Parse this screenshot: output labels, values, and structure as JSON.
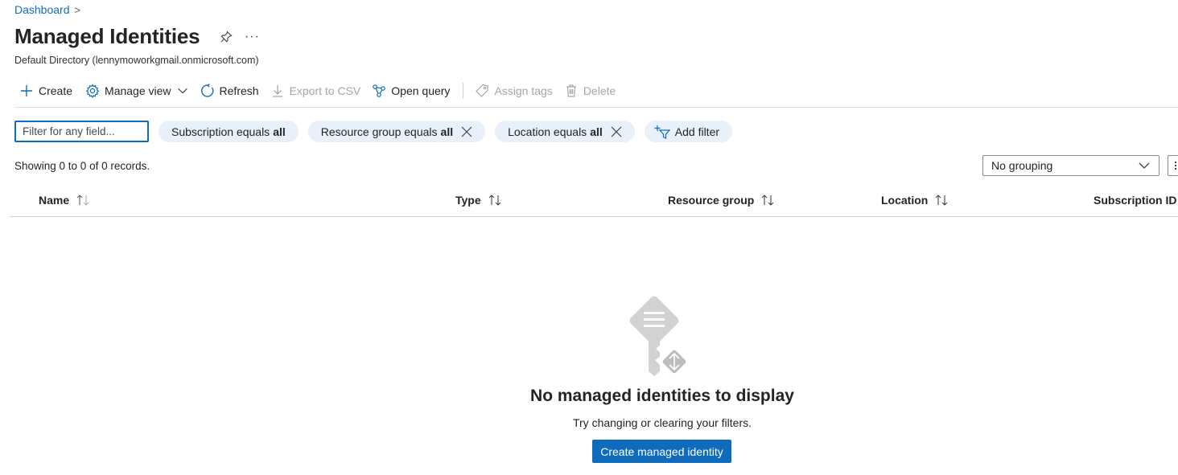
{
  "breadcrumb": {
    "link": "Dashboard"
  },
  "header": {
    "title": "Managed Identities",
    "more": "···",
    "subtitle": "Default Directory (lennymoworkgmail.onmicrosoft.com)"
  },
  "toolbar": {
    "create": "Create",
    "manage_view": "Manage view",
    "refresh": "Refresh",
    "export_csv": "Export to CSV",
    "open_query": "Open query",
    "assign_tags": "Assign tags",
    "delete": "Delete"
  },
  "filters": {
    "input_placeholder": "Filter for any field...",
    "pills": [
      {
        "label": "Subscription equals",
        "value": "all",
        "removable": false
      },
      {
        "label": "Resource group equals",
        "value": "all",
        "removable": true
      },
      {
        "label": "Location equals",
        "value": "all",
        "removable": true
      }
    ],
    "add_filter": "Add filter"
  },
  "records_text": "Showing 0 to 0 of 0 records.",
  "grouping": {
    "selected": "No grouping"
  },
  "table": {
    "columns": [
      "Name",
      "Type",
      "Resource group",
      "Location",
      "Subscription ID"
    ]
  },
  "empty_state": {
    "title": "No managed identities to display",
    "subtitle": "Try changing or clearing your filters.",
    "button": "Create managed identity"
  },
  "colors": {
    "accent": "#0f6cbd",
    "pill_bg": "#e8f0fa",
    "disabled_text": "#a6a6a6"
  }
}
